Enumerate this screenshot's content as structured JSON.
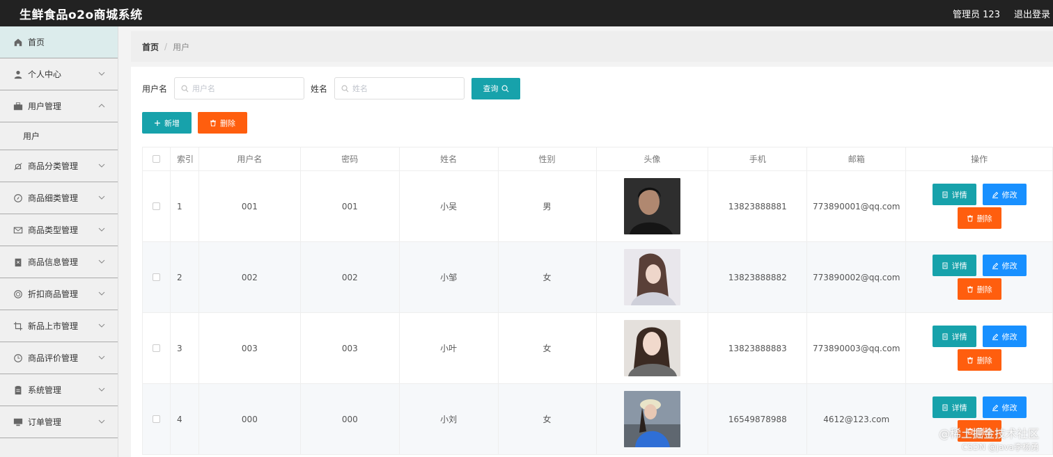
{
  "header": {
    "title": "生鲜食品o2o商城系统",
    "user": "管理员 123",
    "logout": "退出登录"
  },
  "sidebar": {
    "items": [
      {
        "label": "首页",
        "icon": "home-icon",
        "active": true
      },
      {
        "label": "个人中心",
        "icon": "user-icon"
      },
      {
        "label": "用户管理",
        "icon": "briefcase-icon",
        "expanded": true,
        "sub": "用户"
      },
      {
        "label": "商品分类管理",
        "icon": "bell-icon"
      },
      {
        "label": "商品细类管理",
        "icon": "compass-icon"
      },
      {
        "label": "商品类型管理",
        "icon": "mail-icon"
      },
      {
        "label": "商品信息管理",
        "icon": "clipboard-icon"
      },
      {
        "label": "折扣商品管理",
        "icon": "target-icon"
      },
      {
        "label": "新品上市管理",
        "icon": "crop-icon"
      },
      {
        "label": "商品评价管理",
        "icon": "clock-icon"
      },
      {
        "label": "系统管理",
        "icon": "document-icon"
      },
      {
        "label": "订单管理",
        "icon": "monitor-icon"
      }
    ]
  },
  "breadcrumb": {
    "home": "首页",
    "separator": "/",
    "current": "用户"
  },
  "search": {
    "username_label": "用户名",
    "username_placeholder": "用户名",
    "name_label": "姓名",
    "name_placeholder": "姓名",
    "query_label": "查询"
  },
  "actions": {
    "add": "新增",
    "delete": "删除"
  },
  "table": {
    "headers": [
      "索引",
      "用户名",
      "密码",
      "姓名",
      "性别",
      "头像",
      "手机",
      "邮箱",
      "操作"
    ],
    "rows": [
      {
        "index": "1",
        "username": "001",
        "password": "001",
        "name": "小吴",
        "gender": "男",
        "phone": "13823888881",
        "email": "773890001@qq.com"
      },
      {
        "index": "2",
        "username": "002",
        "password": "002",
        "name": "小邹",
        "gender": "女",
        "phone": "13823888882",
        "email": "773890002@qq.com"
      },
      {
        "index": "3",
        "username": "003",
        "password": "003",
        "name": "小叶",
        "gender": "女",
        "phone": "13823888883",
        "email": "773890003@qq.com"
      },
      {
        "index": "4",
        "username": "000",
        "password": "000",
        "name": "小刘",
        "gender": "女",
        "phone": "16549878988",
        "email": "4612@123.com"
      }
    ],
    "op_labels": {
      "detail": "详情",
      "edit": "修改",
      "delete": "删除"
    }
  },
  "watermark": {
    "line1": "@稀土掘金技术社区",
    "line2": "CSDN @java李杨勇"
  },
  "colors": {
    "teal": "#17a2ab",
    "orange": "#ff5e0e",
    "blue": "#1890ff",
    "topbar": "#222222"
  }
}
